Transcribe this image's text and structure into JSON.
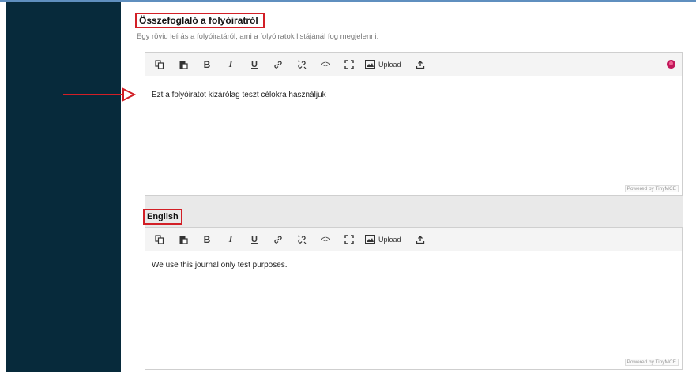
{
  "section": {
    "title": "Összefoglaló a folyóiratról",
    "description": "Egy rövid leírás a folyóiratáról, ami a folyóiratok listájánál fog megjelenni."
  },
  "editors": [
    {
      "content": "Ezt a folyóiratot kizárólag teszt célokra használjuk",
      "powered_by": "Powered by TinyMCE"
    },
    {
      "content": "We use this journal only test purposes.",
      "powered_by": "Powered by TinyMCE"
    }
  ],
  "toolbar": {
    "bold": "B",
    "italic": "I",
    "underline": "U",
    "code": "<>",
    "upload_label": "Upload"
  },
  "english_label": "English",
  "colors": {
    "sidebar": "#072a3b",
    "highlight": "#d21f26",
    "toolbar_bg": "#f4f4f4"
  },
  "icons": [
    "copy-icon",
    "paste-icon",
    "bold-icon",
    "italic-icon",
    "underline-icon",
    "link-icon",
    "unlink-icon",
    "code-icon",
    "fullscreen-icon",
    "image-icon",
    "upload-icon",
    "globe-icon"
  ]
}
